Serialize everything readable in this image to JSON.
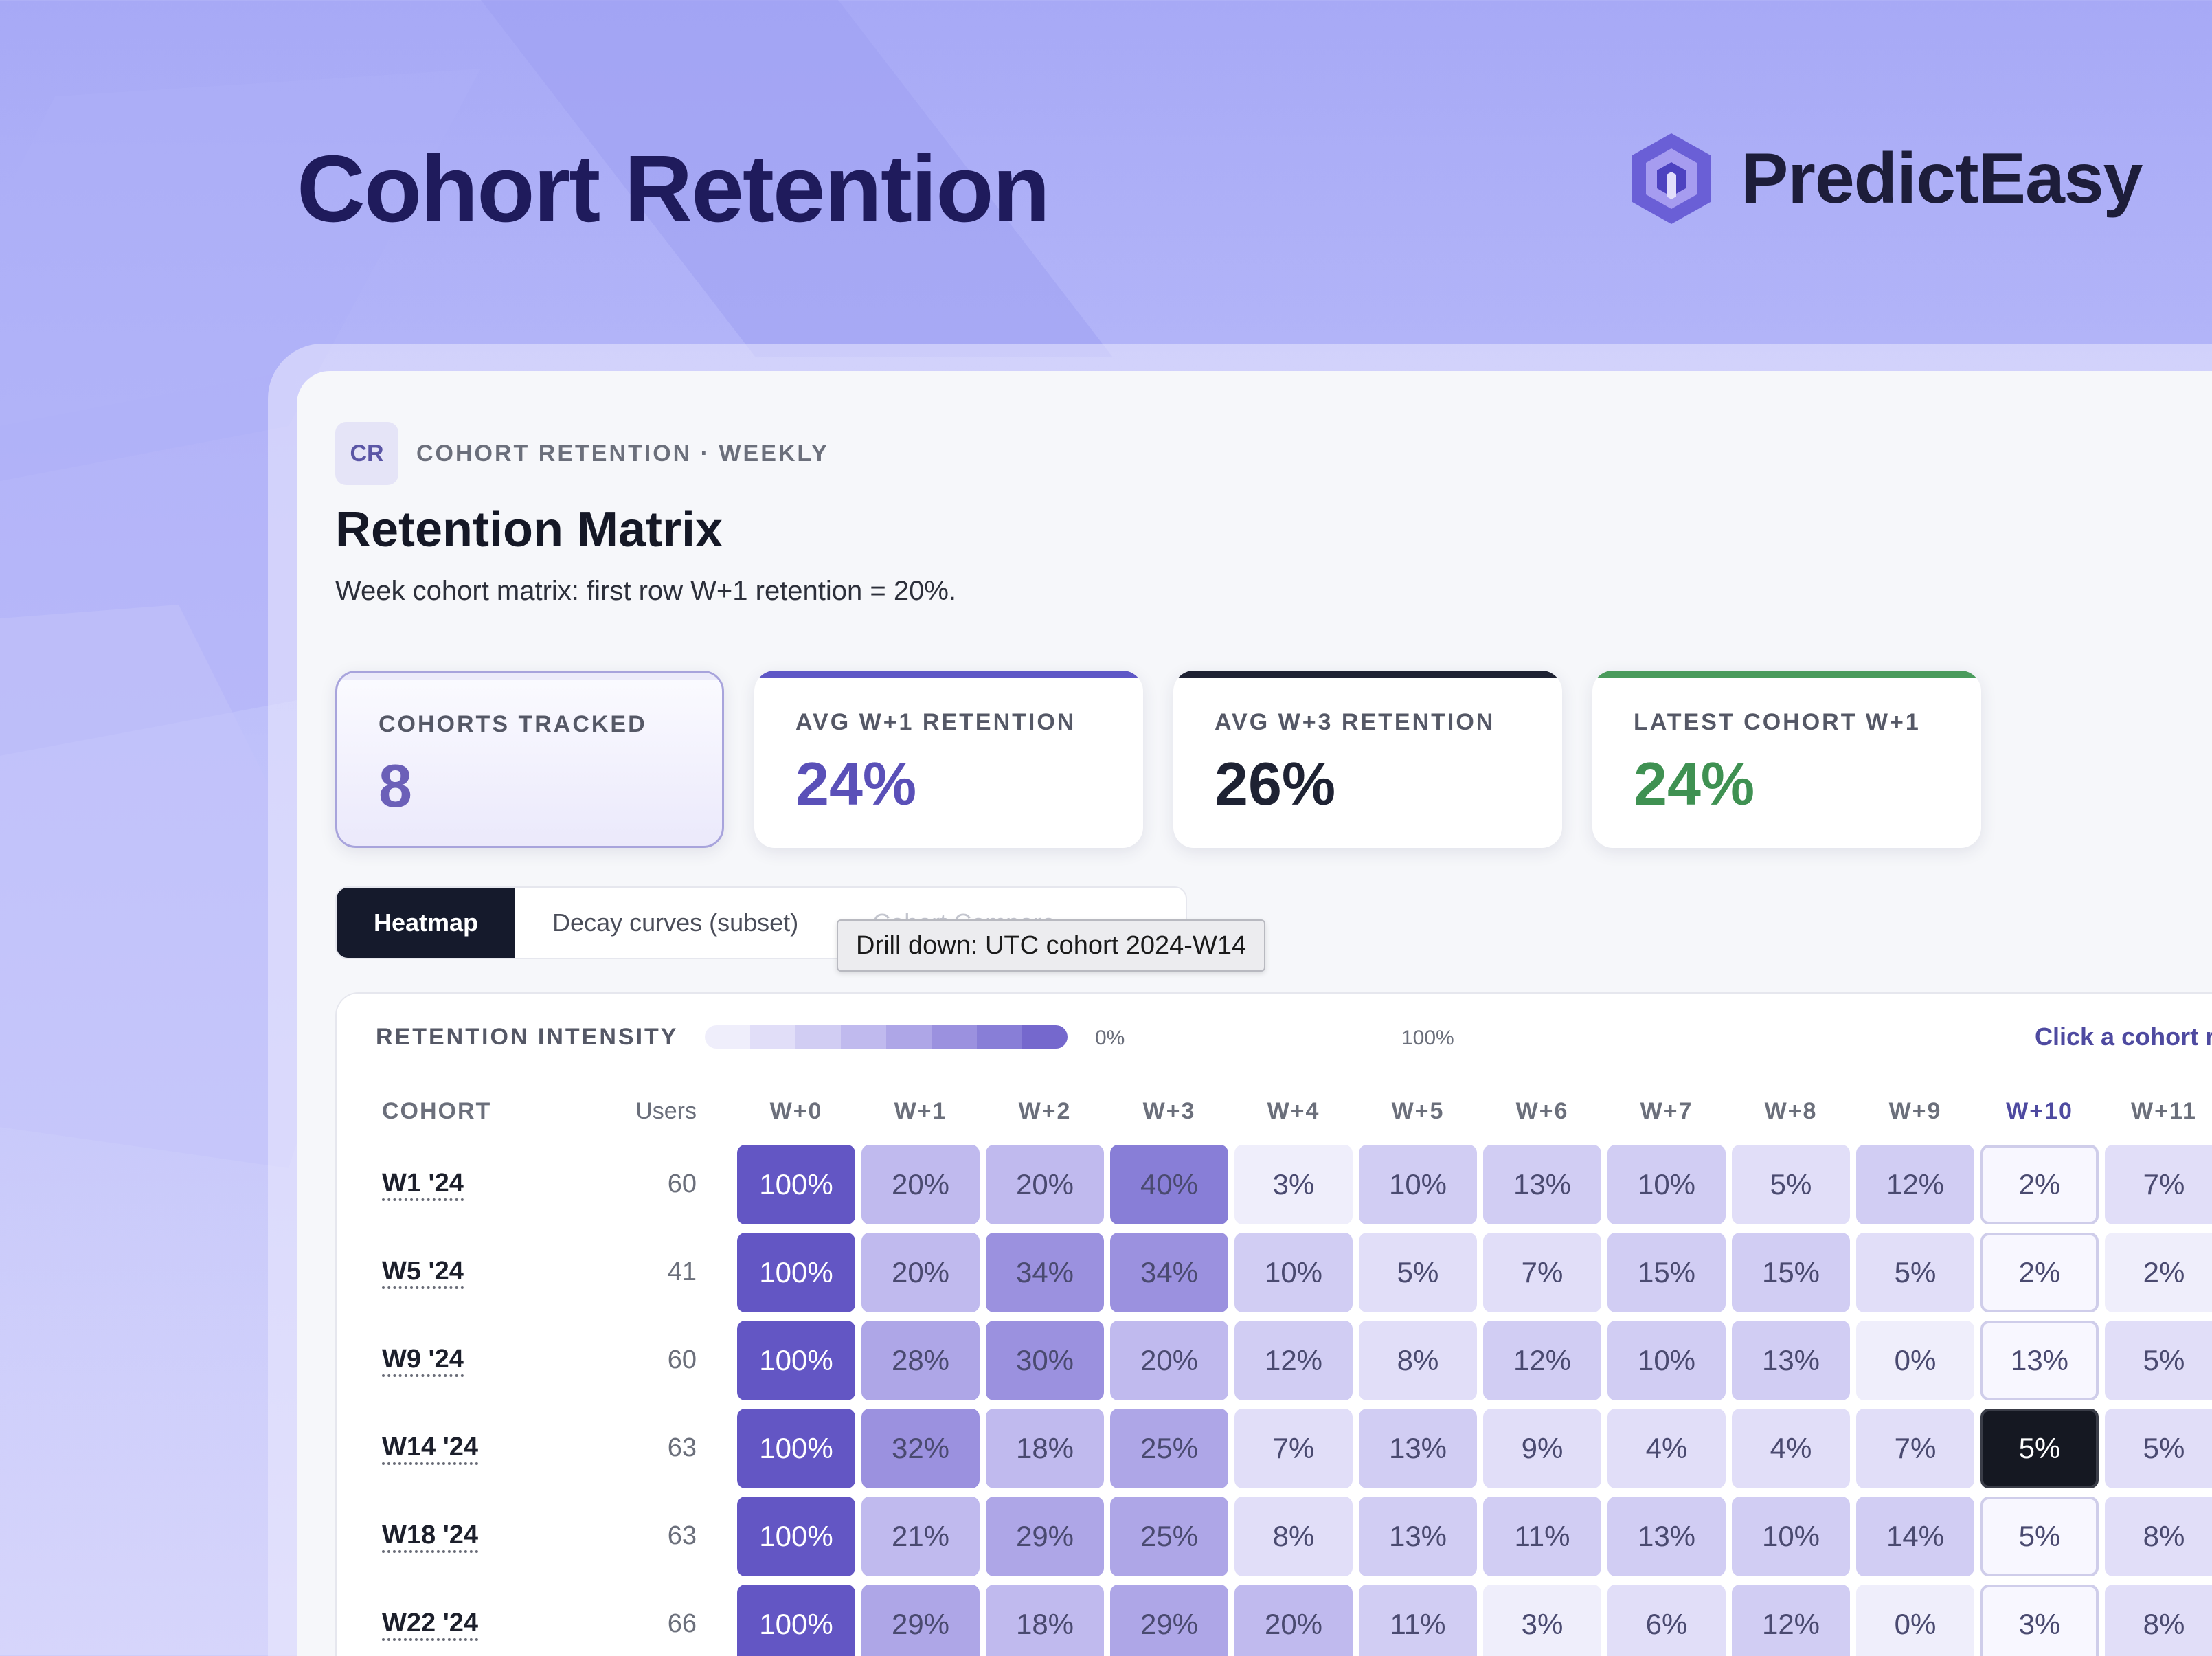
{
  "hero": {
    "title": "Cohort Retention"
  },
  "brand": {
    "name": "PredictEasy",
    "icon": "predicteasy-logo"
  },
  "breadcrumb": {
    "badge": "CR",
    "text": "COHORT RETENTION · WEEKLY"
  },
  "page": {
    "title": "Retention Matrix",
    "subtitle": "Week cohort matrix: first row W+1 retention = 20%."
  },
  "kpis": [
    {
      "label": "COHORTS TRACKED",
      "value": "8",
      "accent": "#ecebfa",
      "value_color": "#6b60b8"
    },
    {
      "label": "AVG W+1 RETENTION",
      "value": "24%",
      "accent": "#5e57c6",
      "value_color": "#5a50b8"
    },
    {
      "label": "AVG W+3 RETENTION",
      "value": "26%",
      "accent": "#1e2233",
      "value_color": "#1e2233"
    },
    {
      "label": "LATEST COHORT W+1",
      "value": "24%",
      "accent": "#4a9b5c",
      "value_color": "#3f9152"
    }
  ],
  "tabs": [
    {
      "label": "Heatmap"
    },
    {
      "label": "Decay curves (subset)"
    },
    {
      "label": "Cohort Compare"
    }
  ],
  "tooltip": {
    "text": "Drill down: UTC cohort 2024-W14"
  },
  "legend": {
    "label": "RETENTION INTENSITY",
    "min": "0%",
    "max": "100%",
    "hint": "Click a cohort row",
    "colors": [
      "#efeefb",
      "#e1def8",
      "#d1cdf3",
      "#c0baee",
      "#aea6e7",
      "#9b91df",
      "#887ed7",
      "#7568cd"
    ]
  },
  "table": {
    "cohort_header": "COHORT",
    "users_header": "Users",
    "weeks": [
      "W+0",
      "W+1",
      "W+2",
      "W+3",
      "W+4",
      "W+5",
      "W+6",
      "W+7",
      "W+8",
      "W+9",
      "W+10",
      "W+11"
    ],
    "highlight_week": "W+10",
    "selected": {
      "cohort": "W14 '24",
      "week": "W+10"
    },
    "rows": [
      {
        "cohort": "W1 '24",
        "users": "60",
        "values": [
          100,
          20,
          20,
          40,
          3,
          10,
          13,
          10,
          5,
          12,
          2,
          7
        ]
      },
      {
        "cohort": "W5 '24",
        "users": "41",
        "values": [
          100,
          20,
          34,
          34,
          10,
          5,
          7,
          15,
          15,
          5,
          2,
          2
        ]
      },
      {
        "cohort": "W9 '24",
        "users": "60",
        "values": [
          100,
          28,
          30,
          20,
          12,
          8,
          12,
          10,
          13,
          0,
          13,
          5
        ]
      },
      {
        "cohort": "W14 '24",
        "users": "63",
        "values": [
          100,
          32,
          18,
          25,
          7,
          13,
          9,
          4,
          4,
          7,
          5,
          5
        ]
      },
      {
        "cohort": "W18 '24",
        "users": "63",
        "values": [
          100,
          21,
          29,
          25,
          8,
          13,
          11,
          13,
          10,
          14,
          5,
          8
        ]
      },
      {
        "cohort": "W22 '24",
        "users": "66",
        "values": [
          100,
          29,
          18,
          29,
          20,
          11,
          3,
          6,
          12,
          0,
          3,
          8
        ]
      }
    ]
  }
}
